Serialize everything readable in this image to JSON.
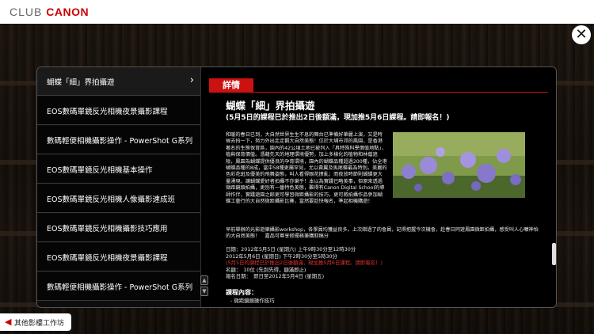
{
  "header": {
    "brand_prefix": "CLUB",
    "brand_name": "CANON"
  },
  "sidebar": {
    "items": [
      {
        "label": "蝴蝶「細」界拍攝遊",
        "active": true
      },
      {
        "label": "EOS數碼單鏡反光相機夜景攝影課程"
      },
      {
        "label": "數碼輕便相機攝影操作 - PowerShot G系列"
      },
      {
        "label": "EOS數碼單鏡反光相機基本操作"
      },
      {
        "label": "EOS數碼單鏡反光相機人像攝影速成班"
      },
      {
        "label": "EOS數碼單鏡反光相機攝影技巧應用"
      },
      {
        "label": "EOS數碼單鏡反光相機夜景攝影課程"
      },
      {
        "label": "數碼輕便相機攝影操作 - PowerShot G系列"
      }
    ],
    "active_chevron": "›"
  },
  "content": {
    "tag": "詳情",
    "title": "蝴蝶「細」界拍攝遊",
    "subtitle": "(5月5日的課程已於推出2日後額滿，現加推5月6日課程。請即報名！)",
    "paragraph1": "和暖的春日已到，大自然世界生生不息的舞台已準備好華麗上演，又是時候去拍一下，努力外出走走觀大自然美態！位於大埔市郊的鳳園，是香港著名的生態保育區，園內的42公頃土地已被列入「具特殊科學價值地點」，植與保育價值。憑藉先天的地理環境優勢，加上多樣化的植物和林蔭遮陰，鳳園為蝴蝶提供優良的孕育環境，園內的蝴蝶品種超過200種，佔全港蝴蝶品種的8成，當中58種更屬罕見，尤以黃翼及馬尾蝶最為特別。美麗的色彩花斑及優美的飛舞姿態，叫人看得眼花撩亂；而夜放時節則蝴蝶更大量湧現，讓蝴蝶愛好者拍攝不亦樂乎！本以為實踐已略美事，但原來透過微距鏡頭拍攝，更別有一番特色美態，難得有Canon Digital School的導師作伴，實踐遊園之餘更可學習微距攝影的技巧，更可將拍攝作品參加蝴蝶工藝行的大自然微距攝影比賽，當然要趁快報名，準起相機購遊！",
    "paragraph2": "早前舉辦的光影遊樂攝影workshop，各學員均獲益良多。上次錯過了的會員，記得把握今次機會，趁春日同遊鳳園微距拍攝，感受叫人心曠神怡的大自然美態！　嘉品可尊享修擺務兼購取稿分",
    "date_label": "日期：",
    "date1": "2012年5月5日 (星期六) 上午9時30分至12時30分",
    "date2": "2012年5月6日 (星期日) 下午2時30分至5時30分",
    "date_note": "(5月5日的課程已於推出2日後額滿，現加推5月6日課程。請即報名！)",
    "quota": "名額：　10位 (先到先得，額滿即止)",
    "deadline": "報名日期：　即日至2012年5月4日 (星期五)",
    "course_label": "課程內容：",
    "course_item": "- 微距鏡頭操作技巧"
  },
  "controls": {
    "close_glyph": "✕",
    "scroll_up": "▲",
    "scroll_down": "▼"
  },
  "footer": {
    "back_label": "其他影樓工作坊",
    "back_icon": "◀"
  }
}
